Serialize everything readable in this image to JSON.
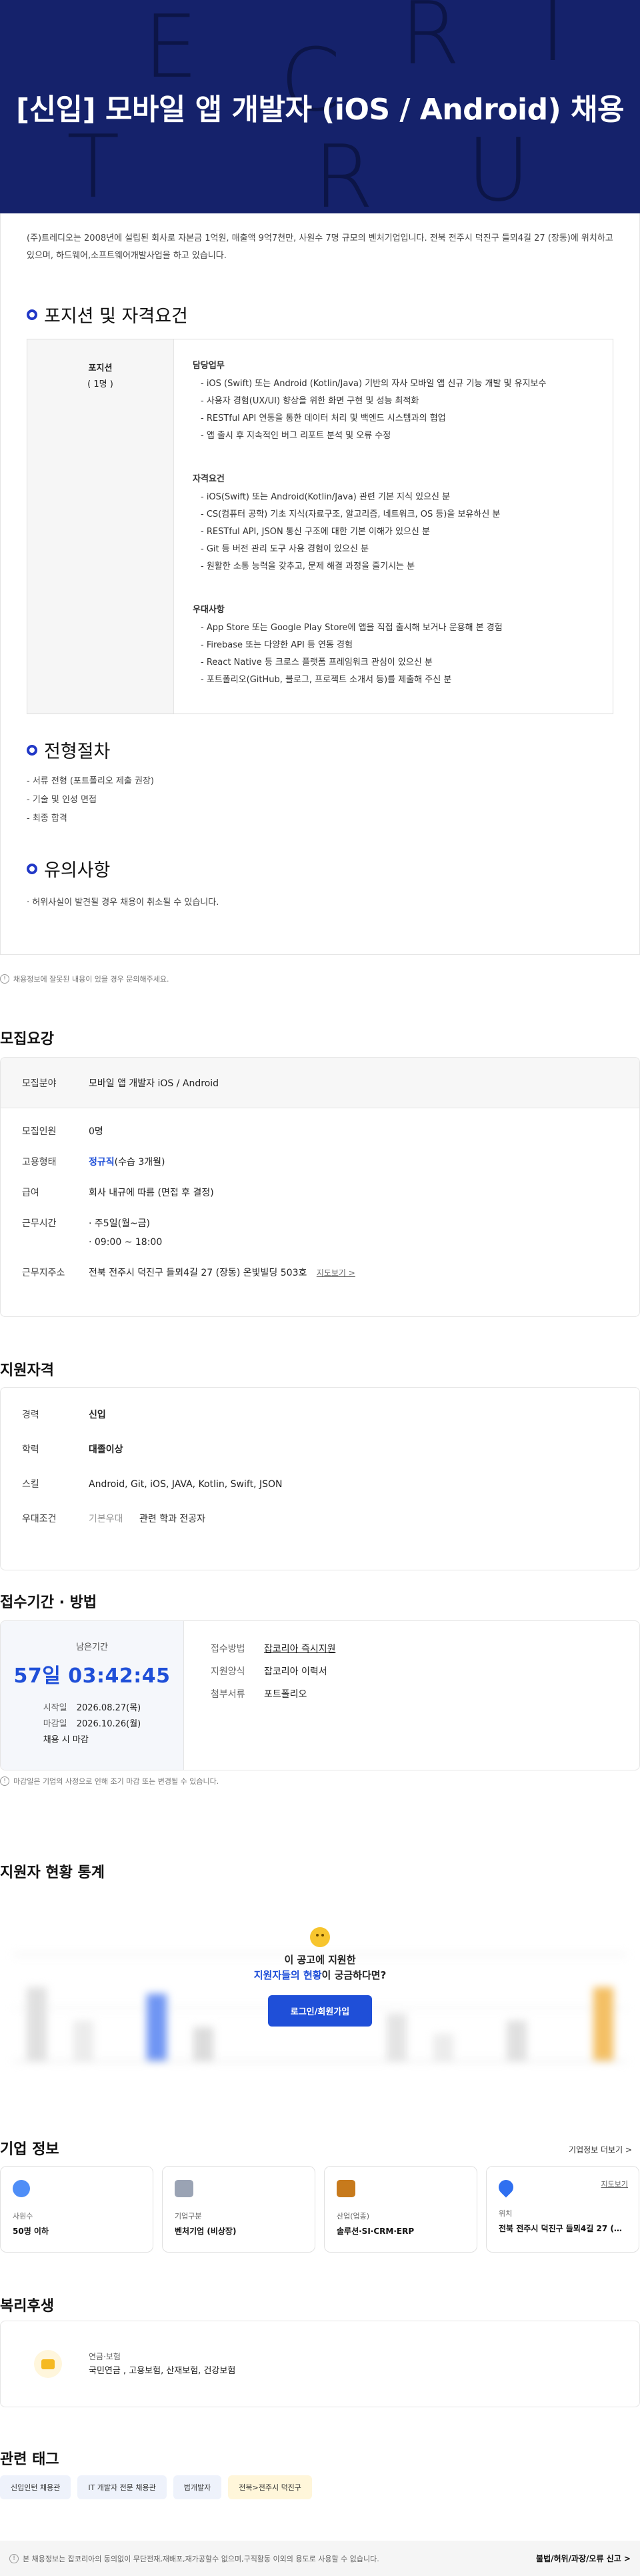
{
  "banner": {
    "title": "[신입] 모바일 앱 개발자 (iOS / Android) 채용",
    "deco_letters": [
      "E",
      "C",
      "R",
      "I",
      "T",
      "R",
      "U"
    ],
    "bg_color": "#15226b"
  },
  "intro": "(주)트레디오는 2008년에 설립된 회사로 자본금 1억원, 매출액 9억7천만, 사원수 7명 규모의 벤처기업입니다. 전북 전주시 덕진구 들뫼4길 27 (장동)에 위치하고 있으며, 하드웨어,소프트웨어개발사업을 하고 있습니다.",
  "position_section": {
    "heading": "포지션 및 자격요건",
    "left_title": "포지션",
    "left_count": "( 1명 )",
    "groups": [
      {
        "title": "담당업무",
        "items": [
          "- iOS (Swift) 또는 Android (Kotlin/Java) 기반의 자사 모바일 앱 신규 기능 개발 및 유지보수",
          "- 사용자 경험(UX/UI) 향상을 위한 화면 구현 및 성능 최적화",
          "- RESTful API 연동을 통한 데이터 처리 및 백엔드 시스템과의 협업",
          "- 앱 출시 후 지속적인 버그 리포트 분석 및 오류 수정"
        ]
      },
      {
        "title": "자격요건",
        "items": [
          "- iOS(Swift) 또는 Android(Kotlin/Java) 관련 기본 지식 있으신 분",
          "- CS(컴퓨터 공학) 기초 지식(자료구조, 알고리즘, 네트워크, OS 등)을 보유하신 분",
          "- RESTful API, JSON 통신 구조에 대한 기본 이해가 있으신 분",
          "- Git 등 버전 관리 도구 사용 경험이 있으신 분",
          "- 원활한 소통 능력을 갖추고, 문제 해결 과정을 즐기시는 분"
        ]
      },
      {
        "title": "우대사항",
        "items": [
          "- App Store 또는 Google Play Store에 앱을 직접 출시해 보거나 운용해 본 경험",
          "- Firebase 또는 다양한 API 등 연동 경험",
          "- React Native 등 크로스 플랫폼 프레임워크 관심이 있으신 분",
          "- 포트폴리오(GitHub, 블로그, 프로젝트 소개서 등)를 제출해 주신 분"
        ]
      }
    ]
  },
  "process_section": {
    "heading": "전형절차",
    "items": [
      "- 서류 전형 (포트폴리오 제출 권장)",
      "- 기술 및 인성 면접",
      "- 최종 합격"
    ]
  },
  "caution_section": {
    "heading": "유의사항",
    "items": [
      "· 허위사실이 발견될 경우 채용이 취소될 수 있습니다."
    ]
  },
  "report_notice": "채용정보에 잘못된 내용이 있을 경우 문의해주세요.",
  "summary": {
    "heading": "모집요강",
    "field_label": "모집분야",
    "field_value": "모바일 앱 개발자 iOS / Android",
    "rows": [
      {
        "label": "모집인원",
        "value": "0명"
      },
      {
        "label": "고용형태",
        "value_blue": "정규직",
        "value": "(수습 3개월)"
      },
      {
        "label": "급여",
        "value": "회사 내규에 따름 (면접 후 결정)"
      }
    ],
    "worktime_label": "근무시간",
    "worktime_items": [
      "· 주5일(월~금)",
      "· 09:00 ~ 18:00"
    ],
    "address_label": "근무지주소",
    "address_value": "전북 전주시 덕진구 들뫼4길 27 (장동) 온빛빌딩 503호",
    "map_link": "지도보기 >"
  },
  "qualification": {
    "heading": "지원자격",
    "rows": [
      {
        "label": "경력",
        "value_blue": "신입"
      },
      {
        "label": "학력",
        "value_blue": "대졸이상"
      },
      {
        "label": "스킬",
        "value": "Android, Git, iOS, JAVA, Kotlin, Swift, JSON"
      }
    ],
    "pref_label": "우대조건",
    "pref_tag": "기본우대",
    "pref_value": "관련 학과 전공자"
  },
  "period": {
    "heading": "접수기간 · 방법",
    "remaining_label": "남은기간",
    "remaining_value": "57일 03:42:45",
    "start_label": "시작일",
    "start_value": "2026.08.27(목)",
    "end_label": "마감일",
    "end_value": "2026.10.26(월)",
    "end_note": "채용 시 마감",
    "method_label": "접수방법",
    "method_value": "잡코리아 즉시지원",
    "form_label": "지원양식",
    "form_value": "잡코리아 이력서",
    "doc_label": "첨부서류",
    "doc_value": "포트폴리오"
  },
  "period_notice": "마감일은 기업의 사정으로 인해 조기 마감 또는 변경될 수 있습니다.",
  "stats": {
    "heading": "지원자 현황 통계",
    "line1": "이 공고에 지원한",
    "line2_highlight": "지원자들의 현황",
    "line2_rest": "이 궁금하다면?",
    "login_button": "로그인/회원가입"
  },
  "company": {
    "heading": "기업 정보",
    "more_link": "기업정보 더보기 >",
    "cards": [
      {
        "label": "사원수",
        "value": "50명 이하",
        "icon": "people-icon",
        "color": "#4f8ef7"
      },
      {
        "label": "기업구분",
        "value": "벤처기업 (비상장)",
        "icon": "building-icon",
        "color": "#9aa3b4"
      },
      {
        "label": "산업(업종)",
        "value": "솔루션·SI·CRM·ERP",
        "icon": "briefcase-icon",
        "color": "#c77a1c"
      },
      {
        "label": "위치",
        "value": "전북 전주시 덕진구 들뫼4길 27 (장동)",
        "icon": "pin-icon",
        "color": "#2f6ff0",
        "link": "지도보기"
      }
    ]
  },
  "welfare": {
    "heading": "복리후생",
    "label": "연금·보험",
    "value": "국민연금 , 고용보험, 산재보험, 건강보험"
  },
  "tags": {
    "heading": "관련 태그",
    "items": [
      "신입인턴 채용관",
      "IT 개발자 전문 채용관",
      "법개발자",
      "전북>전주시 덕진구"
    ]
  },
  "footer": {
    "notice": "본 채용정보는 잡코리아의 동의없이 무단전재,재배포,재가공할수 없으며,구직활동 이외의 용도로 사용할 수 없습니다.",
    "report": "불법/허위/과장/오류 신고 >"
  }
}
